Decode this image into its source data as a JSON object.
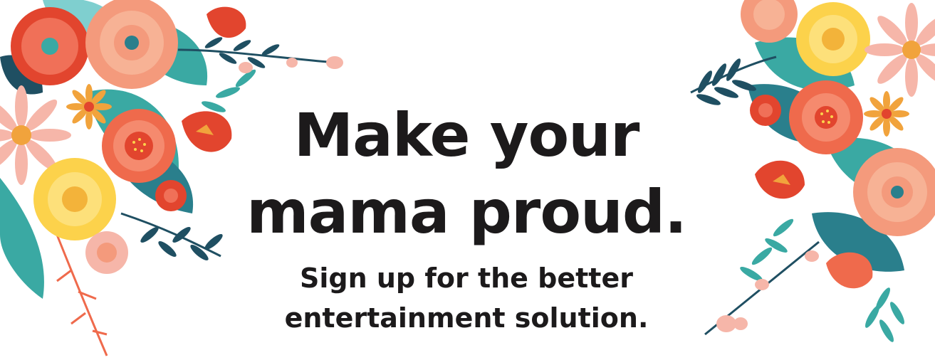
{
  "banner": {
    "headline_line_1": "Make your",
    "headline_line_2": "mama proud.",
    "subheadline_line_1": "Sign up for the better",
    "subheadline_line_2": "entertainment solution."
  },
  "colors": {
    "text": "#1c1a1b",
    "background": "#ffffff",
    "coral": "#ef6a4c",
    "peach": "#f49a7c",
    "pink": "#f6b6a9",
    "yellow": "#fcd24b",
    "teal": "#3aa9a3",
    "dark_teal": "#1f4f62",
    "red_orange": "#e2452e",
    "orange": "#f1a33c"
  },
  "illustrations": {
    "left": "floral-bouquet-illustration",
    "right": "floral-bouquet-illustration"
  }
}
